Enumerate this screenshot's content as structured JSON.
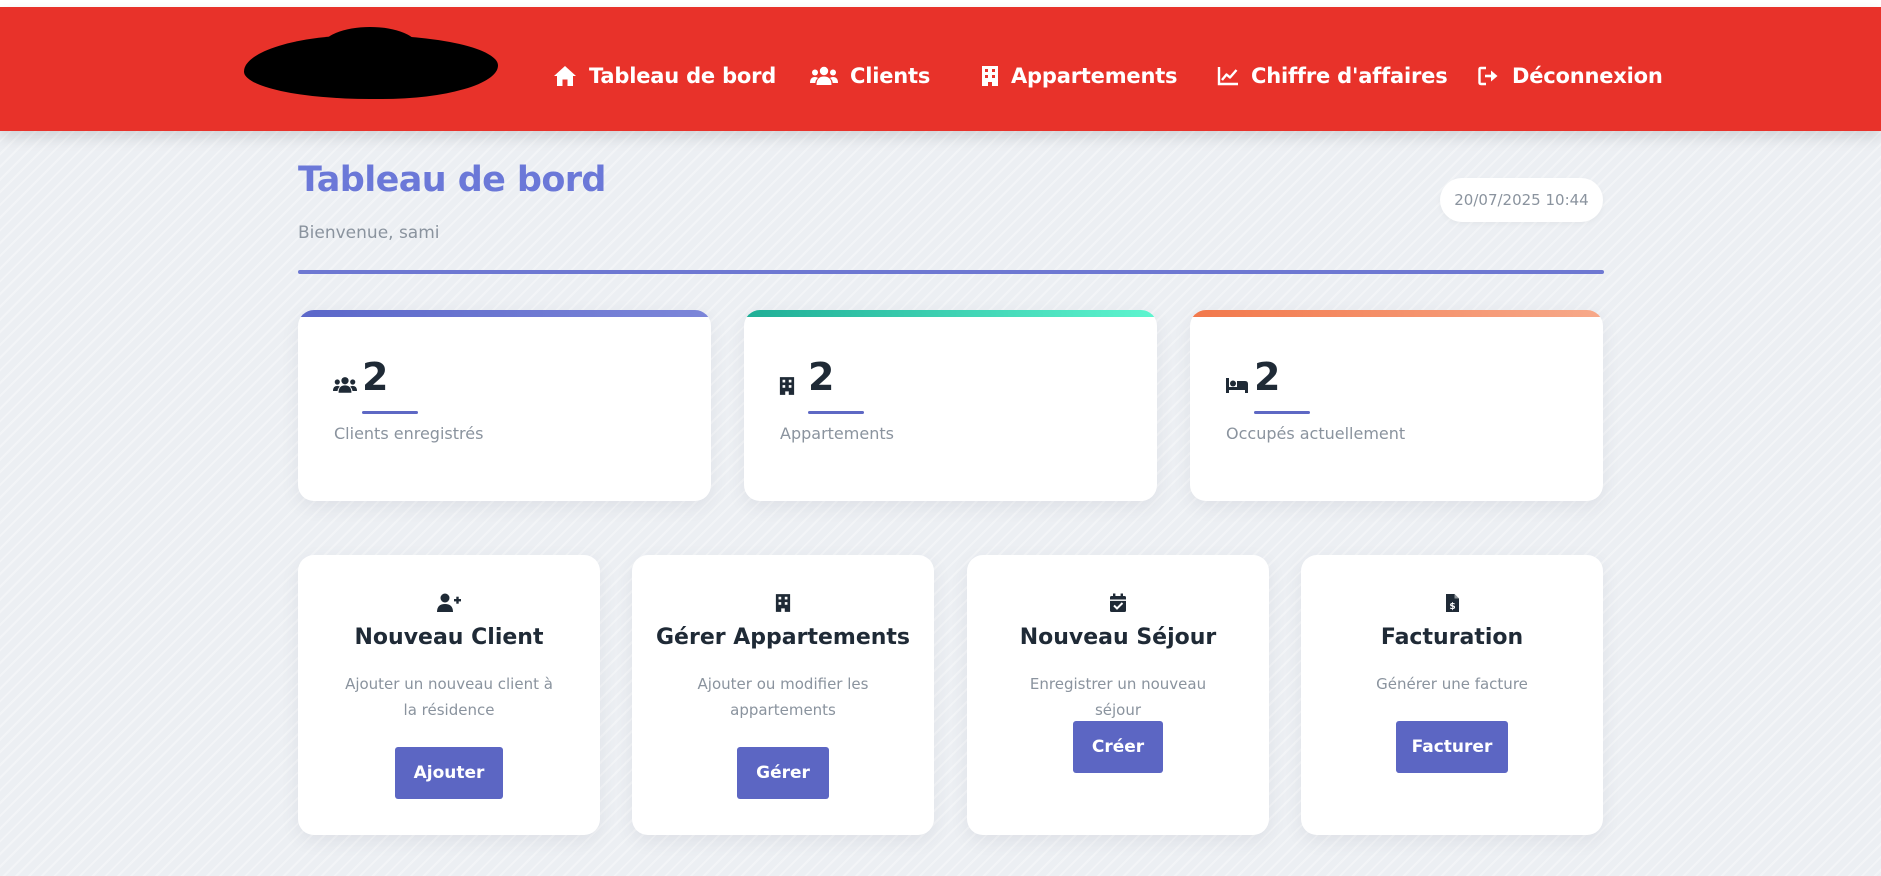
{
  "nav": {
    "items": [
      {
        "label": "Tableau de bord",
        "icon": "home-icon"
      },
      {
        "label": "Clients",
        "icon": "users-icon"
      },
      {
        "label": "Appartements",
        "icon": "building-icon"
      },
      {
        "label": "Chiffre d'affaires",
        "icon": "chart-line-icon"
      },
      {
        "label": "Déconnexion",
        "icon": "logout-icon"
      }
    ],
    "background_color": "#e8322a"
  },
  "header": {
    "title": "Tableau de bord",
    "welcome": "Bienvenue, sami",
    "datetime": "20/07/2025 10:44"
  },
  "stats": [
    {
      "value": "2",
      "label": "Clients enregistrés",
      "icon": "users-icon",
      "accent": [
        "#5b67c9",
        "#7c86d9"
      ]
    },
    {
      "value": "2",
      "label": "Appartements",
      "icon": "building-icon",
      "accent": [
        "#1fae96",
        "#5ef5cf"
      ]
    },
    {
      "value": "2",
      "label": "Occupés actuellement",
      "icon": "bed-icon",
      "accent": [
        "#f2784b",
        "#f7a98a"
      ]
    }
  ],
  "actions": [
    {
      "title": "Nouveau Client",
      "description": "Ajouter un nouveau client à la résidence",
      "button": "Ajouter",
      "icon": "user-plus-icon"
    },
    {
      "title": "Gérer Appartements",
      "description": "Ajouter ou modifier les appartements",
      "button": "Gérer",
      "icon": "building-icon"
    },
    {
      "title": "Nouveau Séjour",
      "description": "Enregistrer un nouveau séjour",
      "button": "Créer",
      "icon": "calendar-check-icon"
    },
    {
      "title": "Facturation",
      "description": "Générer une facture",
      "button": "Facturer",
      "icon": "invoice-icon"
    }
  ],
  "colors": {
    "primary": "#5c66c3",
    "title_gradient_start": "#6b78d8",
    "muted_text": "#8a939e"
  }
}
